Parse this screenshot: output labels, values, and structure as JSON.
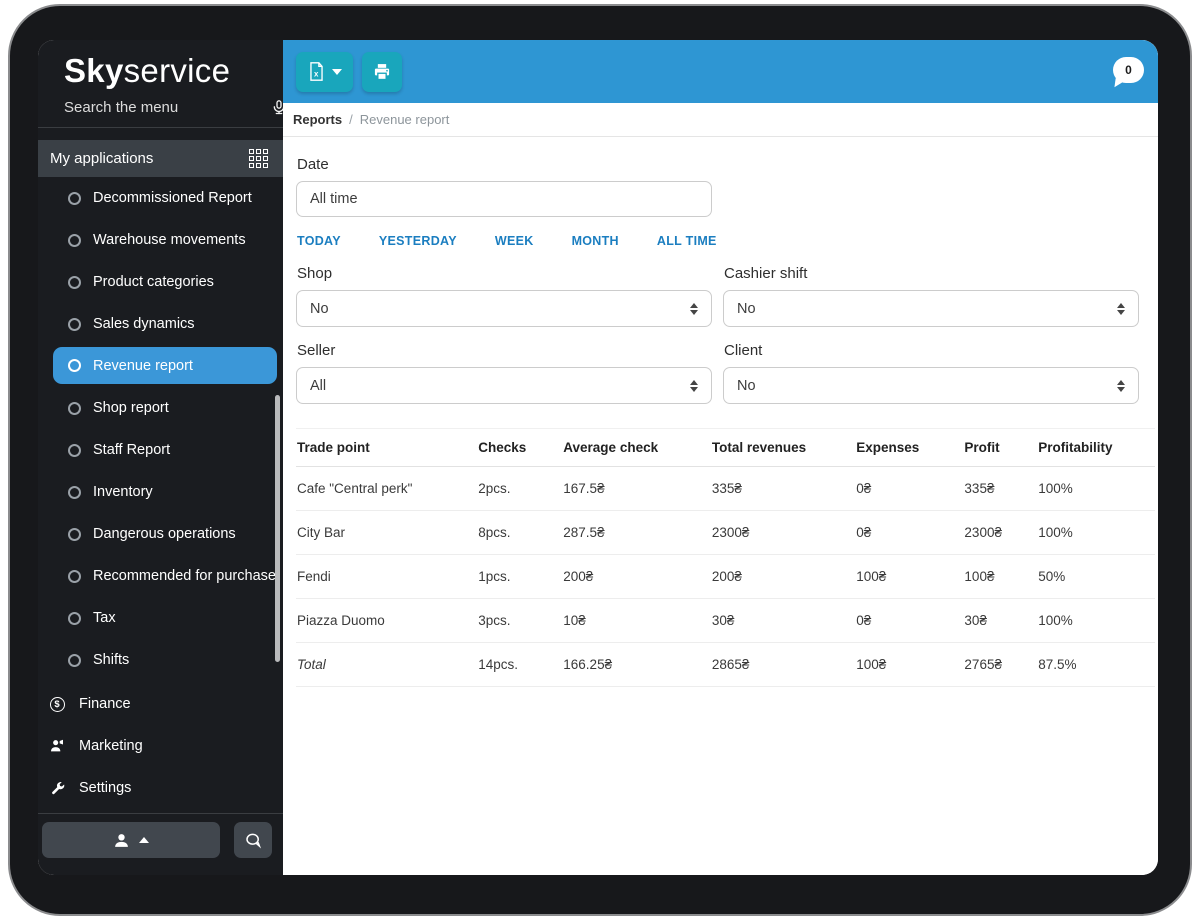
{
  "sidebar": {
    "logo": {
      "bold": "Sky",
      "light": "service"
    },
    "search_placeholder": "Search the menu",
    "section_header": "My applications",
    "menu_items": [
      {
        "label": "Decommissioned Report",
        "active": false
      },
      {
        "label": "Warehouse movements",
        "active": false
      },
      {
        "label": "Product categories",
        "active": false
      },
      {
        "label": "Sales dynamics",
        "active": false
      },
      {
        "label": "Revenue report",
        "active": true
      },
      {
        "label": "Shop report",
        "active": false
      },
      {
        "label": "Staff Report",
        "active": false
      },
      {
        "label": "Inventory",
        "active": false
      },
      {
        "label": "Dangerous operations",
        "active": false
      },
      {
        "label": "Recommended for purchase",
        "active": false
      },
      {
        "label": "Tax",
        "active": false
      },
      {
        "label": "Shifts",
        "active": false
      }
    ],
    "footer_items": [
      {
        "label": "Finance",
        "icon": "dollar-circle-icon"
      },
      {
        "label": "Marketing",
        "icon": "person-icon"
      },
      {
        "label": "Settings",
        "icon": "wrench-icon"
      }
    ],
    "finance_icon_glyph": "$"
  },
  "topbar": {
    "chat_count": "0"
  },
  "breadcrumb": {
    "parent": "Reports",
    "separator": "/",
    "current": "Revenue report"
  },
  "filters": {
    "date_label": "Date",
    "date_value": "All time",
    "quick_ranges": [
      "TODAY",
      "YESTERDAY",
      "WEEK",
      "MONTH",
      "ALL TIME"
    ],
    "shop": {
      "label": "Shop",
      "value": "No"
    },
    "cashier_shift": {
      "label": "Cashier shift",
      "value": "No"
    },
    "seller": {
      "label": "Seller",
      "value": "All"
    },
    "client": {
      "label": "Client",
      "value": "No"
    }
  },
  "table": {
    "columns": [
      "Trade point",
      "Checks",
      "Average check",
      "Total revenues",
      "Expenses",
      "Profit",
      "Profitability"
    ],
    "rows": [
      [
        "Cafe \"Central perk\"",
        "2pcs.",
        "167.5₴",
        "335₴",
        "0₴",
        "335₴",
        "100%"
      ],
      [
        "City Bar",
        "8pcs.",
        "287.5₴",
        "2300₴",
        "0₴",
        "2300₴",
        "100%"
      ],
      [
        "Fendi",
        "1pcs.",
        "200₴",
        "200₴",
        "100₴",
        "100₴",
        "50%"
      ],
      [
        "Piazza Duomo",
        "3pcs.",
        "10₴",
        "30₴",
        "0₴",
        "30₴",
        "100%"
      ]
    ],
    "total": [
      "Total",
      "14pcs.",
      "166.25₴",
      "2865₴",
      "100₴",
      "2765₴",
      "87.5%"
    ]
  },
  "icons": {
    "microphone-icon": "mic",
    "grid-icon": "3x3-squares",
    "circle-icon": "radio-circle",
    "dollar-circle-icon": "dollar-in-circle",
    "person-icon": "person-silhouette",
    "wrench-icon": "wrench",
    "user-icon": "person-silhouette",
    "caret-up-icon": "up-triangle",
    "caret-down-icon": "down-triangle",
    "chat-icon": "speech-bubble",
    "excel-icon": "spreadsheet-document",
    "print-icon": "printer",
    "select-arrows-icon": "up-down-triangles",
    "chat-badge": "speech-bubble"
  },
  "colors": {
    "topbar_blue": "#2e96d3",
    "toolbar_button_teal": "#19a6bc",
    "active_item_blue": "#3b97d8",
    "quick_link_blue": "#1b7ec0",
    "sidebar_bg": "#1a1c20"
  }
}
